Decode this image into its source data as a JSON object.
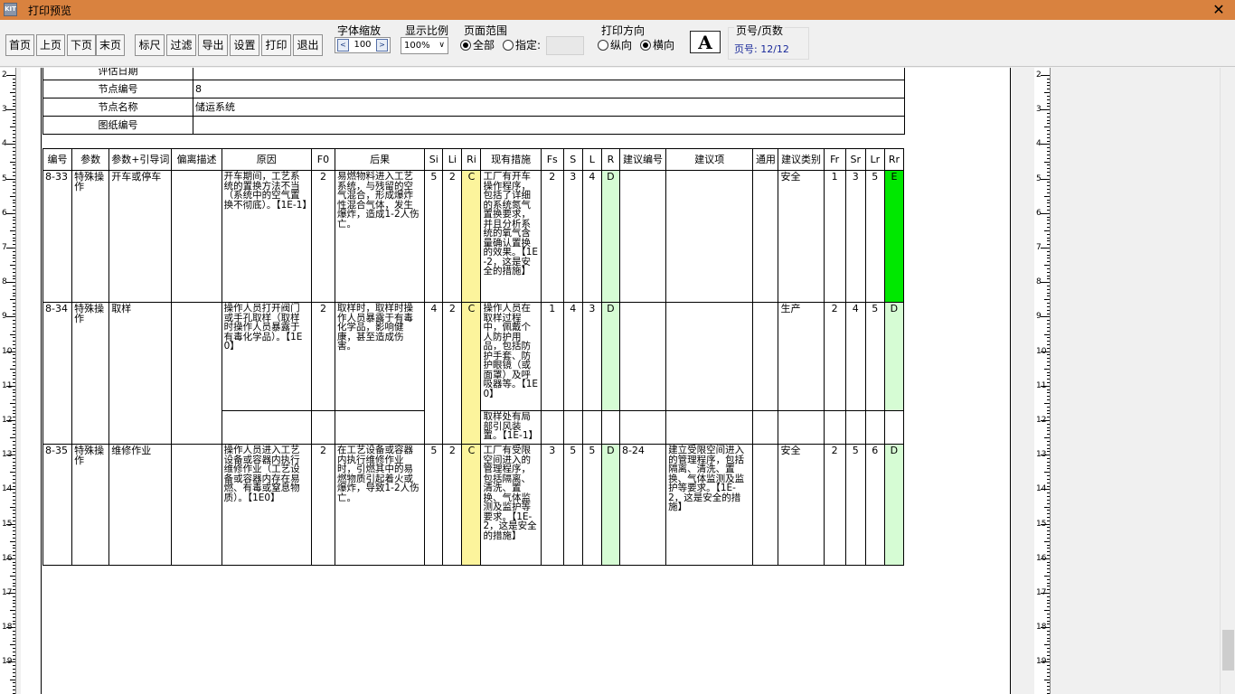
{
  "window": {
    "title": "打印预览",
    "icon_text": "KIT",
    "close": "✕"
  },
  "toolbar": {
    "first": "首页",
    "prev": "上页",
    "next": "下页",
    "last": "末页",
    "ruler": "标尺",
    "filter": "过滤",
    "export": "导出",
    "settings": "设置",
    "print": "打印",
    "exit": "退出",
    "font_zoom_label": "字体缩放",
    "font_zoom_value": "100",
    "font_zoom_dec": "<",
    "font_zoom_inc": ">",
    "display_ratio_label": "显示比例",
    "display_ratio_value": "100%",
    "display_ratio_arrow": "∨",
    "page_range_label": "页面范围",
    "range_all": "全部",
    "range_specify": "指定:",
    "orientation_label": "打印方向",
    "portrait": "纵向",
    "landscape": "横向",
    "font_button": "A",
    "page_label": "页号/页数",
    "page_value": "页号:  12/12"
  },
  "ruler": {
    "numbers": [
      "2",
      "3",
      "4",
      "5",
      "6",
      "7",
      "8",
      "9",
      "10",
      "11",
      "12",
      "13",
      "14",
      "15",
      "16",
      "17",
      "18",
      "19"
    ]
  },
  "info": [
    {
      "label": "评估日期",
      "value": ""
    },
    {
      "label": "节点编号",
      "value": "8"
    },
    {
      "label": "节点名称",
      "value": "储运系统"
    },
    {
      "label": "图纸编号",
      "value": ""
    }
  ],
  "table": {
    "headers": [
      "编号",
      "参数",
      "参数+引导词",
      "偏离描述",
      "原因",
      "F0",
      "后果",
      "Si",
      "Li",
      "Ri",
      "现有措施",
      "Fs",
      "S",
      "L",
      "R",
      "建议编号",
      "建议项",
      "通用",
      "建议类别",
      "Fr",
      "Sr",
      "Lr",
      "Rr"
    ],
    "rows": [
      {
        "id": "8-33",
        "param": "特殊操作",
        "guide": "开车或停车",
        "desc": "",
        "cause": "开车期间，工艺系统的置换方法不当（系统中的空气置换不彻底）。【1E-1】",
        "f0": "2",
        "cons": "易燃物料进入工艺系统，与残留的空气混合，形成爆炸性混合气体，发生爆炸，造成1-2人伤亡。",
        "si": "5",
        "li": "2",
        "ri": "C",
        "meas": "工厂有开车操作程序，包括了详细的系统氮气置换要求，并且分析系统的氧气含量确认置换的效果。【1E-2，这是安全的措施】",
        "fs": "2",
        "s": "3",
        "l": "4",
        "r": "D",
        "sid": "",
        "sug": "",
        "gen": "",
        "cat": "安全",
        "fr": "1",
        "sr": "3",
        "lr": "5",
        "rr": "E"
      },
      {
        "id": "8-34",
        "param": "特殊操作",
        "guide": "取样",
        "desc": "",
        "cause": "操作人员打开阀门或手孔取样（取样时操作人员暴露于有毒化学品）。【1E0】",
        "f0": "2",
        "cons": "取样时，取样时操作人员暴露于有毒化学品，影响健康，甚至造成伤害。",
        "si": "4",
        "li": "2",
        "ri": "C",
        "meas": "操作人员在取样过程中，佩戴个人防护用品，包括防护手套、防护眼镜（或面罩）及呼吸器等。【1E0】",
        "meas2": "取样处有局部引风装置。【1E-1】",
        "fs": "1",
        "s": "4",
        "l": "3",
        "r": "D",
        "sid": "",
        "sug": "",
        "gen": "",
        "cat": "生产",
        "fr": "2",
        "sr": "4",
        "lr": "5",
        "rr": "D"
      },
      {
        "id": "8-35",
        "param": "特殊操作",
        "guide": "维修作业",
        "desc": "",
        "cause": "操作人员进入工艺设备或容器内执行维修作业（工艺设备或容器内存在易燃、有毒或窒息物质）。【1E0】",
        "f0": "2",
        "cons": "在工艺设备或容器内执行维修作业时，引燃其中的易燃物质引起着火或爆炸，导致1-2人伤亡。",
        "si": "5",
        "li": "2",
        "ri": "C",
        "meas": "工厂有受限空间进入的管理程序，包括隔离、清洗、置换、气体监测及监护等要求。【1E-2，这是安全的措施】",
        "fs": "3",
        "s": "5",
        "l": "5",
        "r": "D",
        "sid": "8-24",
        "sug": "建立受限空间进入的管理程序，包括隔离、清洗、置换、气体监测及监护等要求。【1E-2，这是安全的措施】",
        "gen": "",
        "cat": "安全",
        "fr": "2",
        "sr": "5",
        "lr": "6",
        "rr": "D"
      }
    ]
  },
  "colors": {
    "titlebar": "#d9823f",
    "ri_yellow": "#fcf49c",
    "r_light_green": "#d6fcd4",
    "rr_green": "#00e800",
    "page_blue": "#1a2a9a"
  }
}
